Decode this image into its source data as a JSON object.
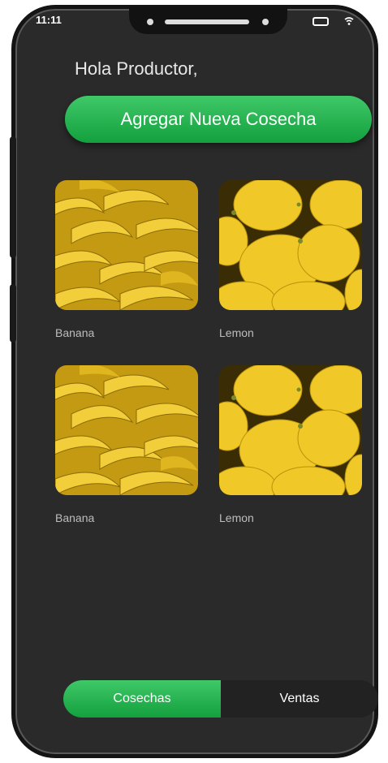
{
  "status_bar": {
    "time": "11:11"
  },
  "header": {
    "greeting": "Hola Productor,"
  },
  "actions": {
    "add_harvest_label": "Agregar Nueva Cosecha"
  },
  "crops": [
    {
      "name": "Banana",
      "image": "bananas-photo"
    },
    {
      "name": "Lemon",
      "image": "lemons-photo"
    },
    {
      "name": "Banana",
      "image": "bananas-photo"
    },
    {
      "name": "Lemon",
      "image": "lemons-photo"
    }
  ],
  "tabs": [
    {
      "label": "Cosechas",
      "active": true
    },
    {
      "label": "Ventas",
      "active": false
    }
  ],
  "colors": {
    "accent_green": "#22b04c",
    "screen_bg": "#303030"
  }
}
